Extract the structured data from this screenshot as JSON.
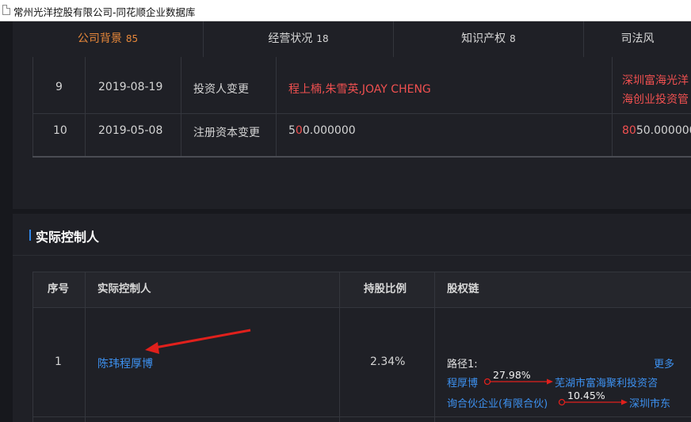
{
  "window": {
    "title": "常州光洋控股有限公司-同花顺企业数据库"
  },
  "tabs": [
    {
      "label": "公司背景",
      "count": "85",
      "active": true
    },
    {
      "label": "经营状况",
      "count": "18",
      "active": false
    },
    {
      "label": "知识产权",
      "count": "8",
      "active": false
    },
    {
      "label": "司法风",
      "count": "",
      "active": false
    }
  ],
  "change_table": {
    "rows": [
      {
        "index": "9",
        "date": "2019-08-19",
        "item": "投资人变更",
        "before": "程上楠,朱雪英,JOAY CHENG",
        "after_line1": "深圳富海光洋",
        "after_line2": "海创业投资管"
      },
      {
        "index": "10",
        "date": "2019-05-08",
        "item": "注册资本变更",
        "before_pre": "5",
        "before_hl": "0",
        "before_post": "0.000000",
        "after_hl": "80",
        "after_post": "50.000000"
      }
    ]
  },
  "controller_section": {
    "title": "实际控制人",
    "headers": {
      "index": "序号",
      "controller": "实际控制人",
      "ratio": "持股比例",
      "chain": "股权链"
    },
    "row": {
      "index": "1",
      "controller": "陈玮程厚博",
      "ratio": "2.34%",
      "path_label": "路径1:",
      "more": "更多",
      "chain_from": "程厚博",
      "chain_pct1": "27.98%",
      "chain_to1": "芜湖市富海聚利投资咨",
      "chain_from2": "询合伙企业(有限合伙)",
      "chain_pct2": "10.45%",
      "chain_to2": "深圳市东"
    }
  },
  "colors": {
    "accent": "#e8883a",
    "link": "#3d91f0",
    "highlight": "#f05050",
    "arrow": "#e0201c",
    "section_bar": "#2f86e8"
  },
  "icons": [
    "document-icon",
    "annotation-arrow-icon",
    "chain-arrow-icon"
  ]
}
